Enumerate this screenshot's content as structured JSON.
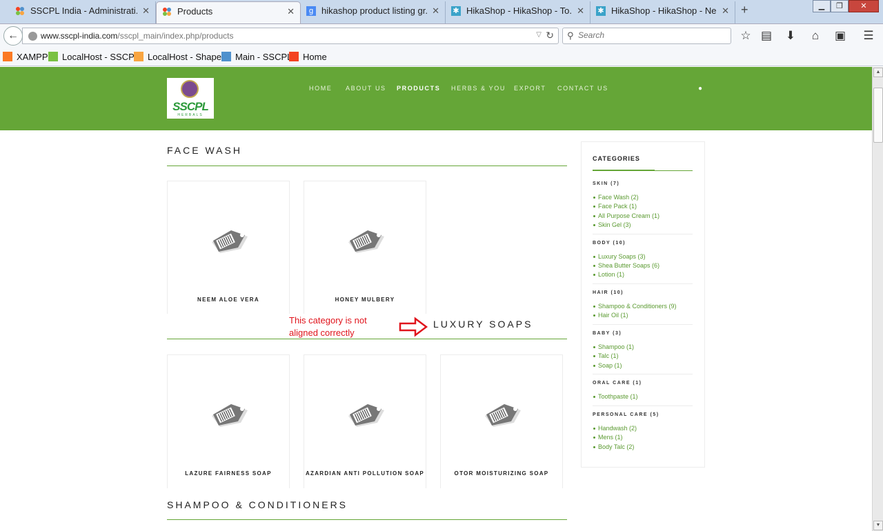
{
  "browser": {
    "tabs": [
      {
        "title": "SSCPL India - Administrati...",
        "icon": "joomla-icon"
      },
      {
        "title": "Products",
        "icon": "joomla-icon"
      },
      {
        "title": "hikashop product listing gr...",
        "icon": "google-icon"
      },
      {
        "title": "HikaShop - HikaShop - To...",
        "icon": "hikashop-icon"
      },
      {
        "title": "HikaShop - HikaShop - Ne...",
        "icon": "hikashop-icon"
      }
    ],
    "tab_close": "✕",
    "new_tab": "+",
    "url_domain": "www.sscpl-india.com",
    "url_path": "/sscpl_main/index.php/products",
    "search_placeholder": "Search",
    "bookmarks": [
      "XAMPP",
      "LocalHost - SSCPL",
      "LocalHost - Shaper",
      "Main - SSCPL",
      "Home"
    ]
  },
  "site": {
    "logo_text": "SSCPL",
    "logo_sub": "HERBALS",
    "menu": [
      "HOME",
      "ABOUT US",
      "PRODUCTS",
      "HERBS & YOU",
      "EXPORT",
      "CONTACT US"
    ],
    "active_menu": "PRODUCTS",
    "categories": [
      {
        "title": "FACE WASH",
        "products": [
          "NEEM ALOE VERA",
          "HONEY MULBERY"
        ]
      },
      {
        "title": "LUXURY SOAPS",
        "products": [
          "LAZURE FAIRNESS SOAP",
          "AZARDIAN ANTI POLLUTION SOAP",
          "OTOR MOISTURIZING SOAP"
        ]
      },
      {
        "title": "SHAMPOO & CONDITIONERS",
        "products": []
      }
    ],
    "sidebar": {
      "title": "CATEGORIES",
      "groups": [
        {
          "name": "SKIN (7)",
          "items": [
            "Face Wash (2)",
            "Face Pack (1)",
            "All Purpose Cream (1)",
            "Skin Gel (3)"
          ]
        },
        {
          "name": "BODY (10)",
          "items": [
            "Luxury Soaps (3)",
            "Shea Butter Soaps (6)",
            "Lotion (1)"
          ]
        },
        {
          "name": "HAIR (10)",
          "items": [
            "Shampoo & Conditioners (9)",
            "Hair Oil (1)"
          ]
        },
        {
          "name": "BABY (3)",
          "items": [
            "Shampoo (1)",
            "Talc (1)",
            "Soap (1)"
          ]
        },
        {
          "name": "ORAL CARE (1)",
          "items": [
            "Toothpaste (1)"
          ]
        },
        {
          "name": "PERSONAL CARE (5)",
          "items": [
            "Handwash (2)",
            "Mens (1)",
            "Body Talc (2)"
          ]
        }
      ]
    },
    "annotation": "This category is not aligned correctly"
  },
  "colors": {
    "brand_green": "#65a637",
    "link_green": "#5a9a30",
    "annotation_red": "#e0141c"
  }
}
